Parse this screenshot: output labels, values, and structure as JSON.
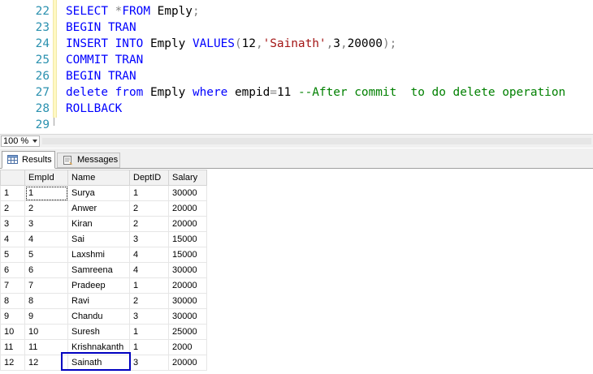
{
  "editor": {
    "lines": [
      {
        "num": "22",
        "tokens": [
          [
            "kw",
            "SELECT "
          ],
          [
            "op",
            "*"
          ],
          [
            "kw",
            "FROM "
          ],
          [
            "tx",
            "Emply"
          ],
          [
            "op",
            ";"
          ]
        ]
      },
      {
        "num": "23",
        "tokens": [
          [
            "kw",
            "BEGIN TRAN"
          ]
        ]
      },
      {
        "num": "24",
        "tokens": [
          [
            "kw",
            "INSERT INTO "
          ],
          [
            "tx",
            "Emply "
          ],
          [
            "kw",
            "VALUES"
          ],
          [
            "op",
            "("
          ],
          [
            "tx",
            "12"
          ],
          [
            "op",
            ","
          ],
          [
            "str",
            "'Sainath'"
          ],
          [
            "op",
            ","
          ],
          [
            "tx",
            "3"
          ],
          [
            "op",
            ","
          ],
          [
            "tx",
            "20000"
          ],
          [
            "op",
            ");"
          ]
        ]
      },
      {
        "num": "25",
        "tokens": [
          [
            "kw",
            "COMMIT TRAN"
          ]
        ]
      },
      {
        "num": "26",
        "tokens": [
          [
            "kw",
            "BEGIN TRAN"
          ]
        ]
      },
      {
        "num": "27",
        "tokens": [
          [
            "kw",
            "delete from "
          ],
          [
            "tx",
            "Emply "
          ],
          [
            "kw",
            "where "
          ],
          [
            "tx",
            "empid"
          ],
          [
            "op",
            "="
          ],
          [
            "tx",
            "11 "
          ],
          [
            "cm",
            "--After commit  to do delete operation"
          ]
        ]
      },
      {
        "num": "28",
        "tokens": [
          [
            "kw",
            "ROLLBACK"
          ]
        ]
      },
      {
        "num": "29",
        "tokens": []
      }
    ],
    "colors": {
      "keyword": "#0000ff",
      "string": "#a31515",
      "comment": "#008000",
      "operator": "#808080",
      "line_number": "#2b91af"
    }
  },
  "zoom": {
    "value": "100 %"
  },
  "tabs": [
    {
      "label": "Results",
      "icon": "grid-icon",
      "active": true
    },
    {
      "label": "Messages",
      "icon": "messages-icon",
      "active": false
    }
  ],
  "results": {
    "columns": [
      "EmpId",
      "Name",
      "DeptID",
      "Salary"
    ],
    "rows": [
      {
        "n": "1",
        "cells": [
          "1",
          "Surya",
          "1",
          "30000"
        ]
      },
      {
        "n": "2",
        "cells": [
          "2",
          "Anwer",
          "2",
          "20000"
        ]
      },
      {
        "n": "3",
        "cells": [
          "3",
          "Kiran",
          "2",
          "20000"
        ]
      },
      {
        "n": "4",
        "cells": [
          "4",
          "Sai",
          "3",
          "15000"
        ]
      },
      {
        "n": "5",
        "cells": [
          "5",
          "Laxshmi",
          "4",
          "15000"
        ]
      },
      {
        "n": "6",
        "cells": [
          "6",
          "Samreena",
          "4",
          "30000"
        ]
      },
      {
        "n": "7",
        "cells": [
          "7",
          "Pradeep",
          "1",
          "20000"
        ]
      },
      {
        "n": "8",
        "cells": [
          "8",
          "Ravi",
          "2",
          "30000"
        ]
      },
      {
        "n": "9",
        "cells": [
          "9",
          "Chandu",
          "3",
          "30000"
        ]
      },
      {
        "n": "10",
        "cells": [
          "10",
          "Suresh",
          "1",
          "25000"
        ]
      },
      {
        "n": "11",
        "cells": [
          "11",
          "Krishnakanth",
          "1",
          "2000"
        ]
      },
      {
        "n": "12",
        "cells": [
          "12",
          "Sainath",
          "3",
          "20000"
        ]
      }
    ],
    "highlight_color": "#0000c0"
  }
}
